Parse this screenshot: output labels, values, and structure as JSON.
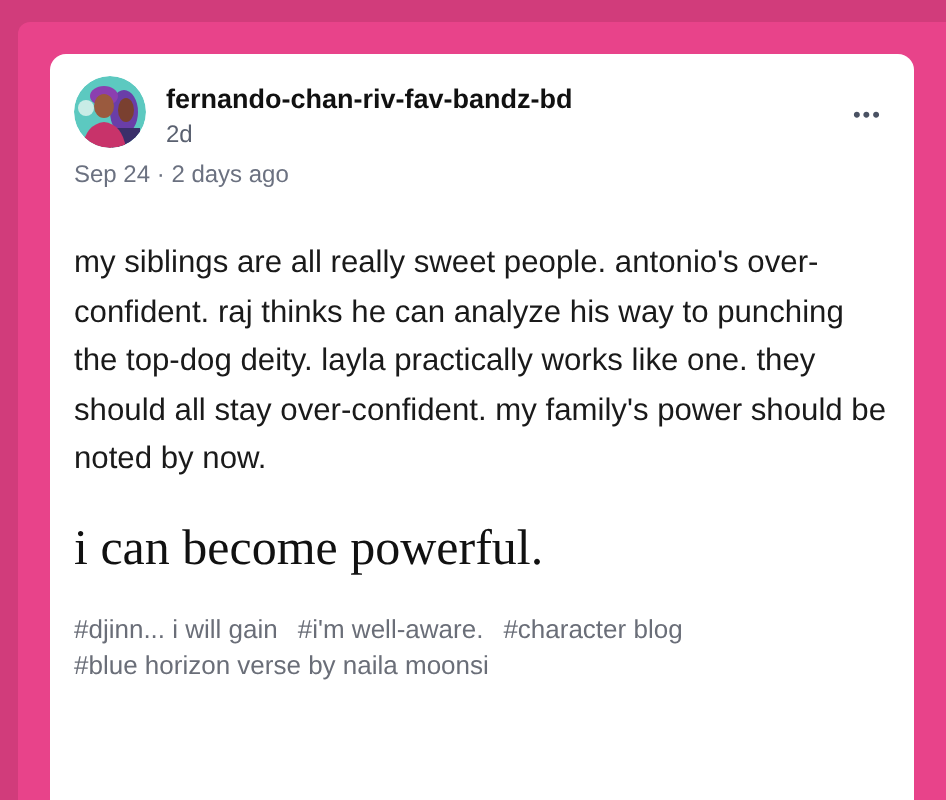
{
  "post": {
    "author": "fernando-chan-riv-fav-bandz-bd",
    "age": "2d",
    "date": "Sep 24 · 2 days ago",
    "menu": "•••",
    "body": "my siblings are all really sweet people. antonio's over-confident. raj thinks he can analyze his way to punching the top-dog deity. layla practically works like one. they should all stay over-confident. my family's power should be noted by now.",
    "headline": "i can become powerful.",
    "tags": [
      "#djinn... i will gain",
      "#i'm well-aware.",
      "#character blog",
      "#blue horizon verse by naila moonsi"
    ]
  }
}
